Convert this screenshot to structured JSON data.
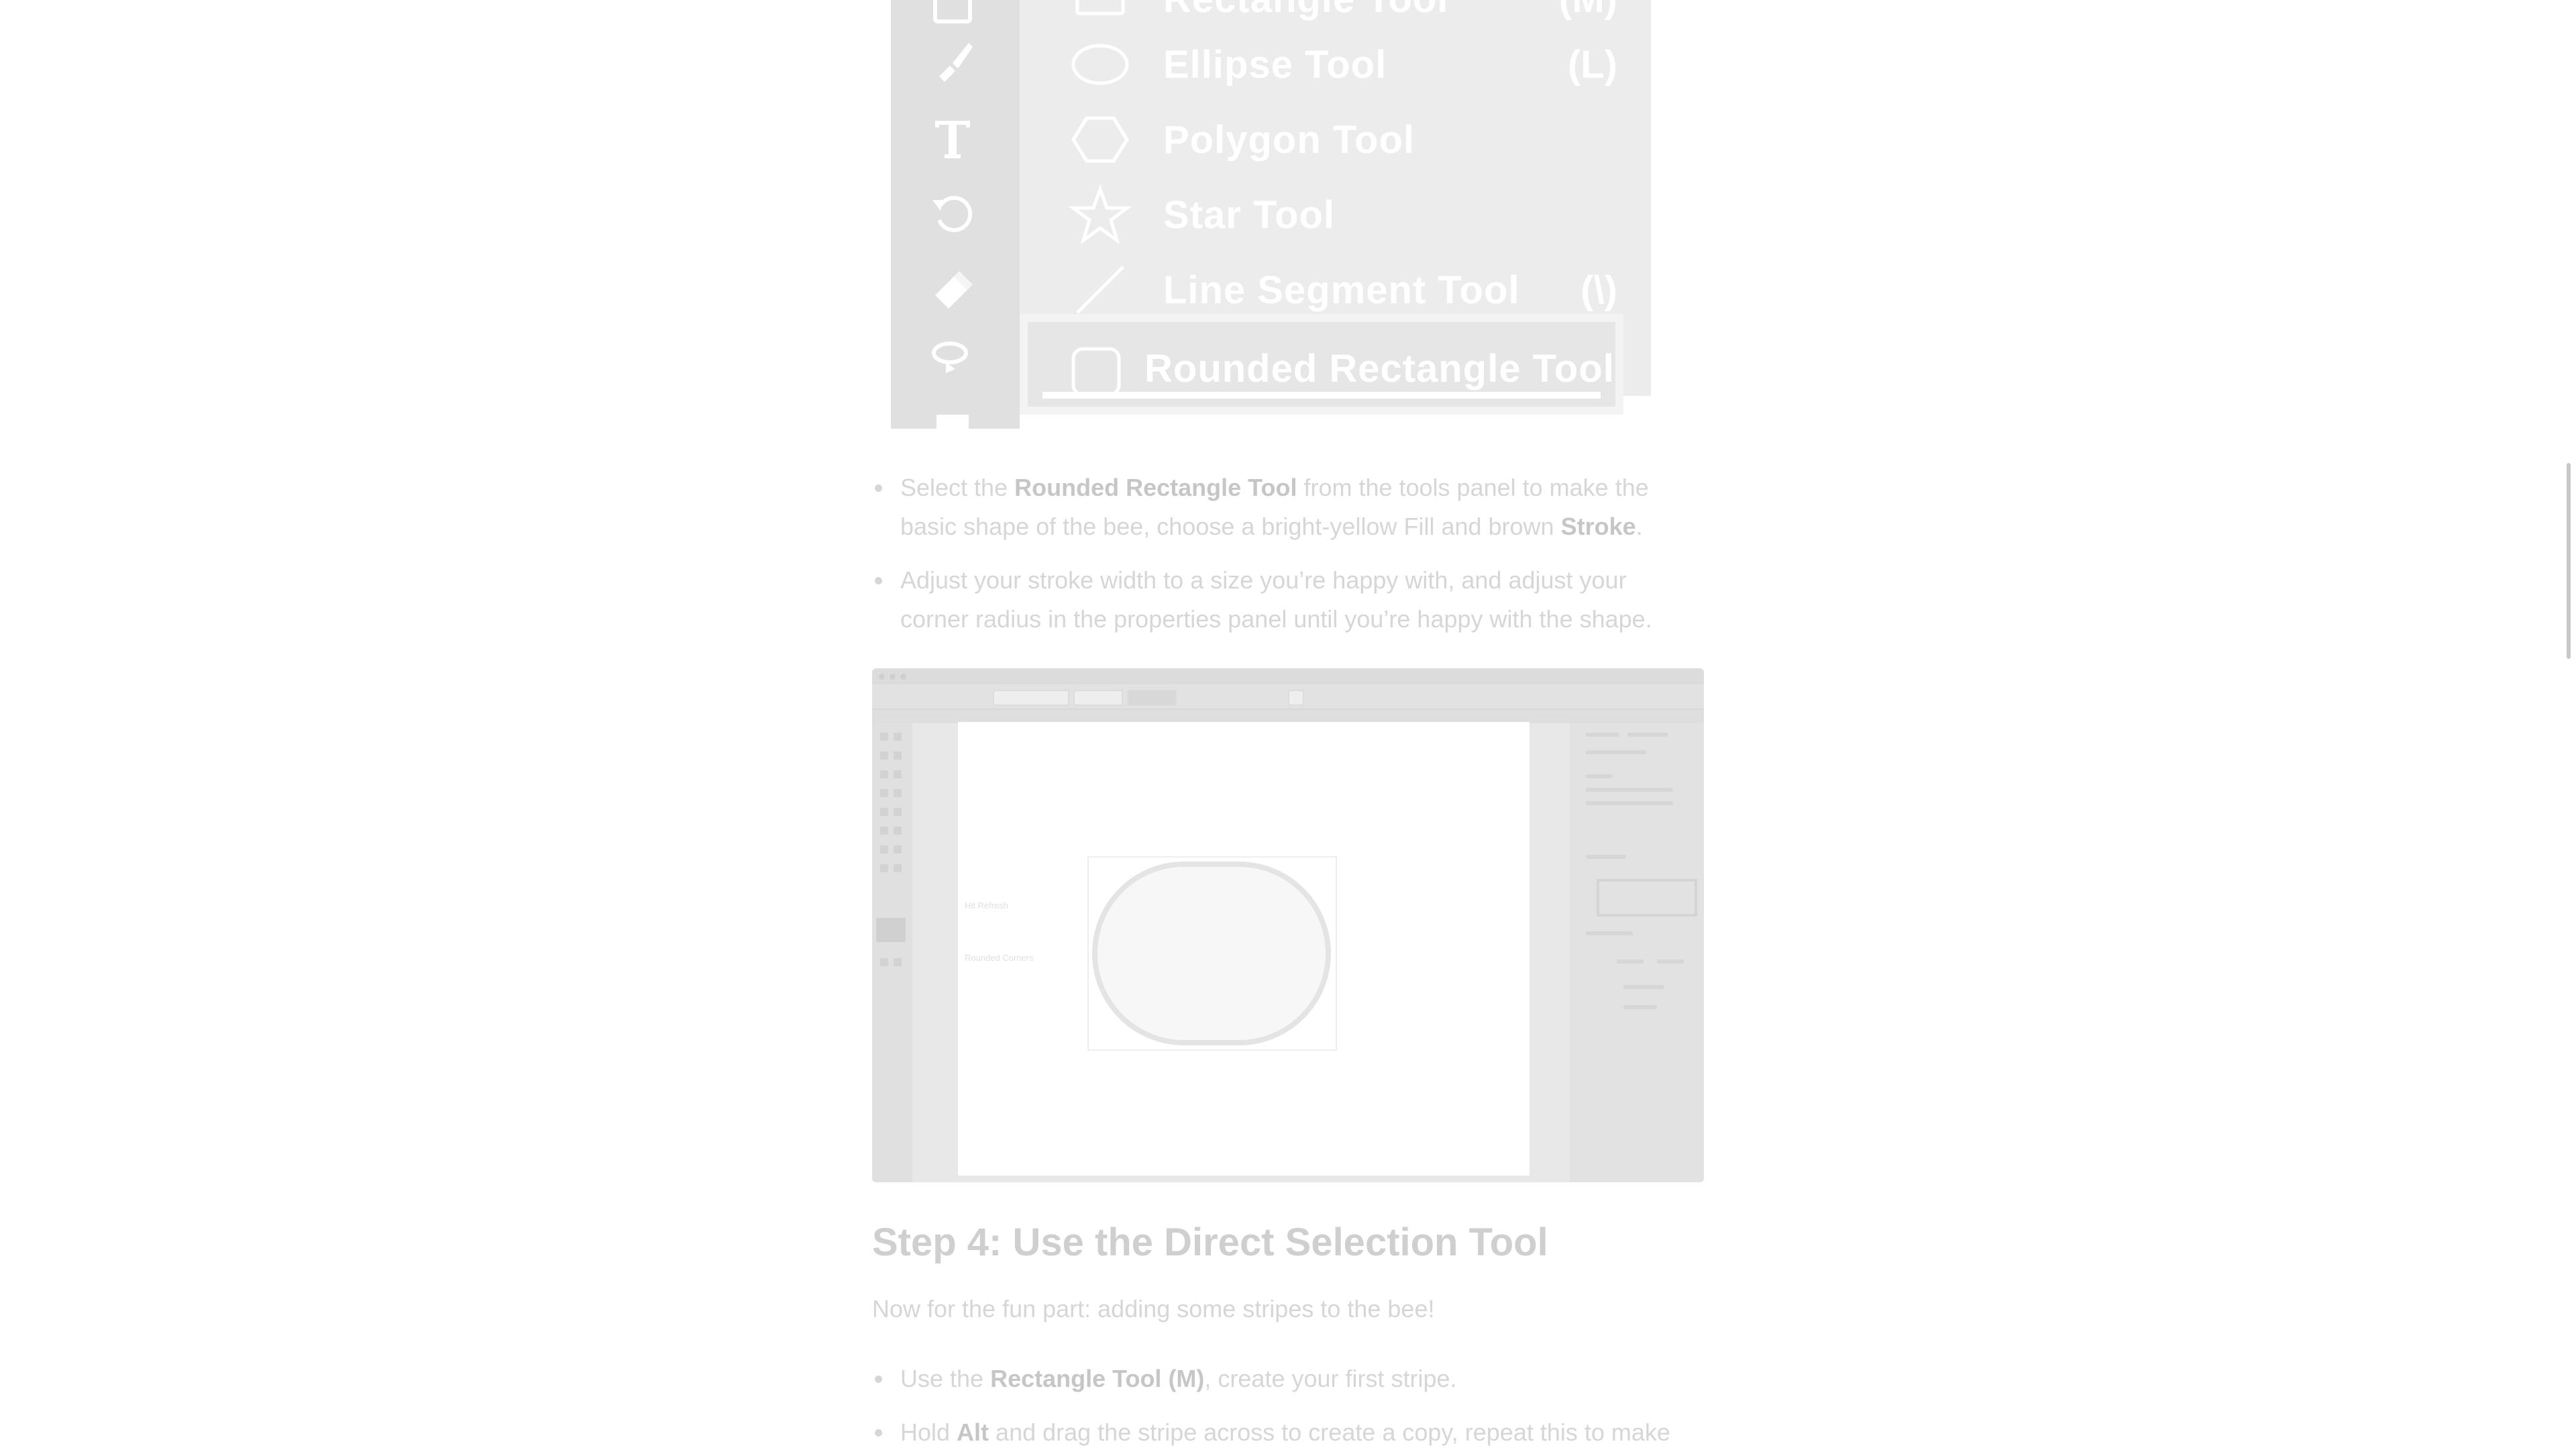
{
  "flyout_menu": {
    "items": [
      {
        "label": "Rectangle Tool",
        "shortcut": "(M)",
        "icon": "rectangle-icon"
      },
      {
        "label": "Ellipse Tool",
        "shortcut": "(L)",
        "icon": "ellipse-icon"
      },
      {
        "label": "Polygon Tool",
        "shortcut": "",
        "icon": "polygon-icon"
      },
      {
        "label": "Star Tool",
        "shortcut": "",
        "icon": "star-icon"
      },
      {
        "label": "Line Segment Tool",
        "shortcut": "(\\)",
        "icon": "line-icon"
      },
      {
        "label": "Rounded Rectangle Tool",
        "shortcut": "",
        "icon": "rounded-rectangle-icon"
      }
    ],
    "toolbar_icons": [
      "rectangle-tool-icon",
      "paintbrush-icon",
      "type-icon",
      "rotate-icon",
      "eraser-icon",
      "lasso-icon",
      "gradient-icon"
    ]
  },
  "bullets_1": [
    {
      "pre": "Select the ",
      "bold1": "Rounded Rectangle Tool",
      "mid": " from the tools panel to make the basic shape of the bee, choose a bright-yellow Fill and brown ",
      "bold2": "Stroke",
      "post": "."
    },
    {
      "text": "Adjust your stroke width to a size you’re happy with, and adjust your corner radius in the properties panel until you’re happy with the shape."
    }
  ],
  "app_screenshot": {
    "canvas_notes": [
      "Hit Refresh",
      "Rounded Corners"
    ]
  },
  "step4": {
    "heading": "Step 4: Use the Direct Selection Tool",
    "intro": "Now for the fun part: adding some stripes to the bee!",
    "bullets": [
      {
        "pre": "Use the ",
        "bold": "Rectangle Tool (M)",
        "post": ", create your first stripe."
      },
      {
        "pre": "Hold ",
        "bold": "Alt",
        "post": " and drag the stripe across to create a copy, repeat this to make"
      }
    ]
  }
}
